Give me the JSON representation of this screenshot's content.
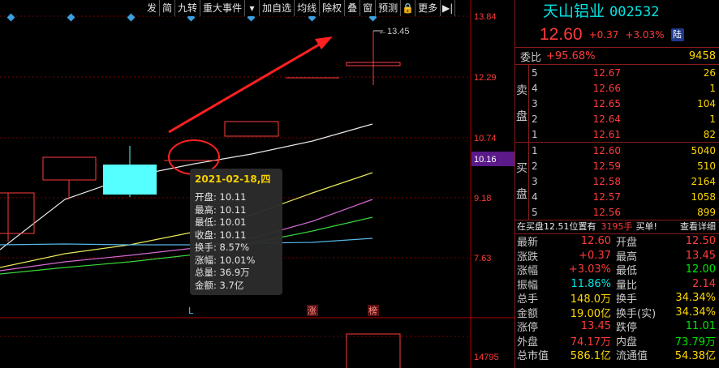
{
  "chart": {
    "price_ticks": [
      "13.84",
      "12.29",
      "10.74",
      "9.18",
      "7.63"
    ],
    "current_price_tag": "10.16",
    "high_annotation": "13.45",
    "volume_tick": "14795",
    "bottom_markers": [
      "L",
      "涨",
      "榜"
    ],
    "colors": {
      "up": "#ff3b3b",
      "down": "#55ffff",
      "axis": "#b00000"
    }
  },
  "toolbar": {
    "items": [
      "发",
      "简",
      "九转",
      "重大事件",
      "▾",
      "加自选",
      "均线",
      "除权",
      "叠",
      "窗",
      "预测",
      "🔒",
      "更多",
      "▶|"
    ]
  },
  "tooltip": {
    "date": "2021-02-18,四",
    "lines": [
      "开盘: 10.11",
      "最高: 10.11",
      "最低: 10.01",
      "收盘: 10.11",
      "换手: 8.57%",
      "涨幅: 10.01%",
      "总量: 36.9万",
      "金额: 3.7亿"
    ]
  },
  "panel": {
    "name": "天山铝业",
    "code": "002532",
    "price": "12.60",
    "change": "+0.37",
    "change_pct": "+3.03%",
    "badge": "陆",
    "weibi_label": "委比",
    "weibi_pct": "+95.68%",
    "weibi_vol": "9458",
    "sell_label": [
      "卖",
      "盘"
    ],
    "buy_label": [
      "买",
      "盘"
    ],
    "sells": [
      {
        "n": "5",
        "p": "12.67",
        "v": "26"
      },
      {
        "n": "4",
        "p": "12.66",
        "v": "1"
      },
      {
        "n": "3",
        "p": "12.65",
        "v": "104"
      },
      {
        "n": "2",
        "p": "12.64",
        "v": "1"
      },
      {
        "n": "1",
        "p": "12.61",
        "v": "82"
      }
    ],
    "buys": [
      {
        "n": "1",
        "p": "12.60",
        "v": "5040"
      },
      {
        "n": "2",
        "p": "12.59",
        "v": "510"
      },
      {
        "n": "3",
        "p": "12.58",
        "v": "2164"
      },
      {
        "n": "4",
        "p": "12.57",
        "v": "1058"
      },
      {
        "n": "5",
        "p": "12.56",
        "v": "899"
      }
    ],
    "notice": {
      "text": "在买盘12.51位置有",
      "num": "3195手",
      "text2": "买单!",
      "link": "查看详细"
    },
    "stats": [
      {
        "k": "最新",
        "v": "12.60",
        "vc": "red",
        "k2": "开盘",
        "v2": "12.50",
        "v2c": "red"
      },
      {
        "k": "涨跌",
        "v": "+0.37",
        "vc": "red",
        "k2": "最高",
        "v2": "13.45",
        "v2c": "red"
      },
      {
        "k": "涨幅",
        "v": "+3.03%",
        "vc": "red",
        "k2": "最低",
        "v2": "12.00",
        "v2c": "green"
      },
      {
        "k": "振幅",
        "v": "11.86%",
        "vc": "cyan",
        "k2": "量比",
        "v2": "2.14",
        "v2c": "red"
      },
      {
        "k": "总手",
        "v": "148.0万",
        "vc": "yellow",
        "k2": "换手",
        "v2": "34.34%",
        "v2c": "yellow"
      },
      {
        "k": "金额",
        "v": "19.00亿",
        "vc": "yellow",
        "k2": "换手(实)",
        "v2": "34.34%",
        "v2c": "yellow"
      },
      {
        "k": "涨停",
        "v": "13.45",
        "vc": "red",
        "k2": "跌停",
        "v2": "11.01",
        "v2c": "green"
      },
      {
        "k": "外盘",
        "v": "74.17万",
        "vc": "red",
        "k2": "内盘",
        "v2": "73.79万",
        "v2c": "green"
      },
      {
        "k": "总市值",
        "v": "586.1亿",
        "vc": "yellow",
        "k2": "流通值",
        "v2": "54.38亿",
        "v2c": "yellow"
      }
    ]
  }
}
